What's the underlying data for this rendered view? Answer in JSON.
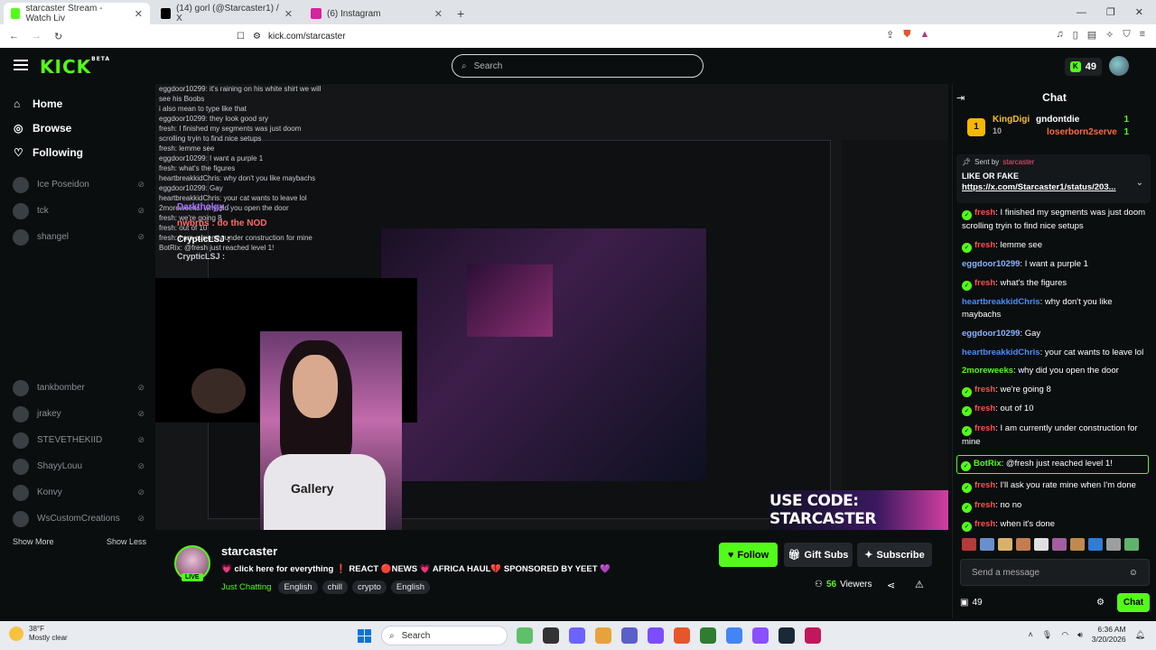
{
  "browser": {
    "tabs": [
      {
        "title": "starcaster Stream - Watch Liv",
        "active": true,
        "color": "#53fc18"
      },
      {
        "title": "(14) gorl (@Starcaster1) / X",
        "active": false,
        "color": "#000000"
      },
      {
        "title": "(6) Instagram",
        "active": false,
        "color": "#d6249f"
      }
    ],
    "url": "kick.com/starcaster"
  },
  "header": {
    "logo": "KICK",
    "logo_badge": "BETA",
    "search_placeholder": "Search",
    "coins": "49"
  },
  "sidebar": {
    "nav": [
      {
        "label": "Home",
        "icon": "home-icon"
      },
      {
        "label": "Browse",
        "icon": "compass-icon"
      },
      {
        "label": "Following",
        "icon": "heart-icon"
      }
    ],
    "followed": [
      "Ice Poseidon",
      "tck",
      "shangel",
      "tankbomber",
      "jrakey",
      "STEVETHEKIID",
      "ShayyLouu",
      "Konvy",
      "WsCustomCreations"
    ],
    "show_more": "Show More",
    "show_less": "Show Less"
  },
  "overlay": {
    "chat_lines": [
      "eggdoor10299: it's raining on his white shirt we will",
      "see his Boobs",
      "i also mean to type like that",
      "eggdoor10299: they look good sry",
      "fresh: I finished my segments was just doom",
      "scrolling tryin to find nice setups",
      "fresh: lemme see",
      "eggdoor10299: I want a purple 1",
      "fresh: what's the figures",
      "heartbreakkidChris: why don't you like maybachs",
      "eggdoor10299: Gay",
      "heartbreakkidChris: your cat wants to leave lol",
      "2moreweeks: why did you open the door",
      "fresh: we're going 8",
      "fresh: out of 10",
      "fresh: I am currently under construction for mine",
      "BotRix: @fresh just reached level 1!"
    ],
    "bold_lines": [
      "Darktholgy :",
      "nwbrns : do the NOD",
      "CrypticLSJ :",
      "CrypticLSJ :"
    ],
    "promo": "USE CODE: STARCASTER",
    "shirt_text": "Gallery"
  },
  "stream": {
    "name": "starcaster",
    "live_label": "LIVE",
    "title": "💗 click here for everything ❗ REACT 🔴NEWS 💗 AFRICA HAUL💔 SPONSORED BY YEET 💜",
    "category": "Just Chatting",
    "tags": [
      "English",
      "chill",
      "crypto",
      "English"
    ],
    "follow": "Follow",
    "gift_subs": "Gift Subs",
    "subscribe": "Subscribe",
    "viewers_count": "56",
    "viewers_label": "Viewers"
  },
  "chat": {
    "title": "Chat",
    "leaderboard": {
      "top": {
        "rank": "1",
        "name": "KingDigi",
        "count": "10"
      },
      "second": {
        "name": "gndontdie",
        "count": "1"
      },
      "third": {
        "name": "loserborn2serve",
        "count": "1"
      }
    },
    "pinned": {
      "sent_by_label": "Sent by",
      "sender": "starcaster",
      "text": "LIKE OR FAKE",
      "link": "https://x.com/Starcaster1/status/203..."
    },
    "messages": [
      {
        "user": "fresh",
        "color": "#ff4f4f",
        "badge": true,
        "text": ": I finished my segments was just doom scrolling tryin to find nice setups"
      },
      {
        "user": "fresh",
        "color": "#ff4f4f",
        "badge": true,
        "text": ": lemme see"
      },
      {
        "user": "eggdoor10299",
        "color": "#8ab4ff",
        "badge": false,
        "text": ": I want a purple 1"
      },
      {
        "user": "fresh",
        "color": "#ff4f4f",
        "badge": true,
        "text": ": what's the figures"
      },
      {
        "user": "heartbreakkidChris",
        "color": "#4a8cff",
        "badge": false,
        "text": ": why don't you like maybachs"
      },
      {
        "user": "eggdoor10299",
        "color": "#8ab4ff",
        "badge": false,
        "text": ": Gay"
      },
      {
        "user": "heartbreakkidChris",
        "color": "#4a8cff",
        "badge": false,
        "text": ": your cat wants to leave lol"
      },
      {
        "user": "2moreweeks",
        "color": "#53fc18",
        "badge": false,
        "text": ": why did you open the door"
      },
      {
        "user": "fresh",
        "color": "#ff4f4f",
        "badge": true,
        "text": ": we're going 8"
      },
      {
        "user": "fresh",
        "color": "#ff4f4f",
        "badge": true,
        "text": ": out of 10"
      },
      {
        "user": "fresh",
        "color": "#ff4f4f",
        "badge": true,
        "text": ": I am currently under construction for mine"
      },
      {
        "user": "BotRix",
        "color": "#53fc18",
        "badge": true,
        "text": ": @fresh just reached level 1!",
        "highlight": true
      },
      {
        "user": "fresh",
        "color": "#ff4f4f",
        "badge": true,
        "text": ": I'll ask you rate mine when I'm done"
      },
      {
        "user": "fresh",
        "color": "#ff4f4f",
        "badge": true,
        "text": ": no no"
      },
      {
        "user": "fresh",
        "color": "#ff4f4f",
        "badge": true,
        "text": ": when it's done"
      }
    ],
    "input_placeholder": "Send a message",
    "points": "49",
    "send_button": "Chat"
  },
  "taskbar": {
    "weather_temp": "38°F",
    "weather_desc": "Mostly clear",
    "search": "Search",
    "time": "6:36 AM",
    "date": "3/20/2026"
  }
}
